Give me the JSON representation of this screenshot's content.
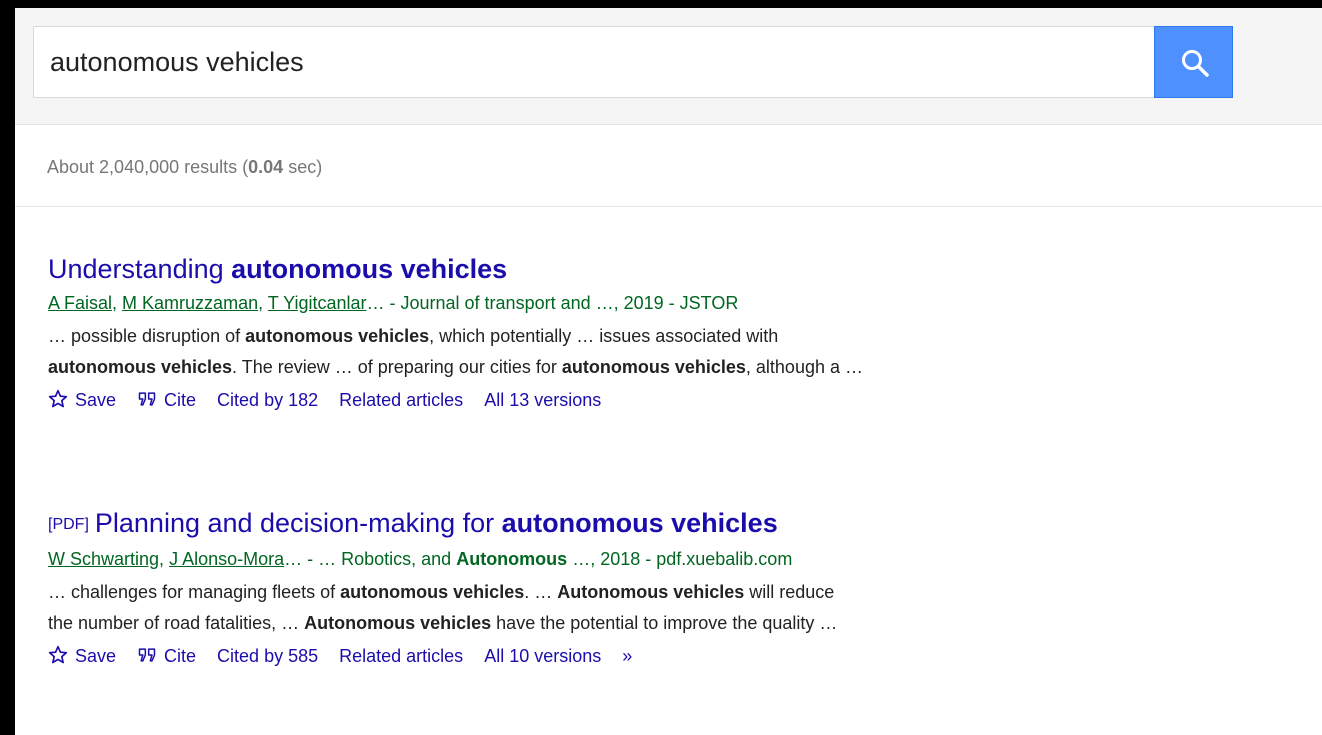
{
  "search": {
    "query": "autonomous vehicles",
    "button_icon": "search-icon",
    "button_color": "#4d90fe"
  },
  "stats": {
    "prefix": "About 2,040,000 results (",
    "time": "0.04",
    "suffix": " sec)"
  },
  "results": [
    {
      "pdf_tag": "",
      "title_prefix": "Understanding ",
      "title_keyword": "autonomous vehicles",
      "title_suffix": "",
      "authors": [
        "A Faisal",
        "M Kamruzzaman",
        "T Yigitcanlar"
      ],
      "author_sep_1": ", ",
      "author_sep_2": ", ",
      "meta_prefix": "… - Journal of transport and …, 2019 - JSTOR",
      "meta_keyword": "",
      "meta_suffix": "",
      "snippet_line1": {
        "a": "… possible disruption of ",
        "kw1": "autonomous vehicles",
        "b": ", which potentially … issues associated with"
      },
      "snippet_line2": {
        "kw1": "autonomous vehicles",
        "a": ". The review … of preparing our cities for ",
        "kw2": "autonomous vehicles",
        "b": ", although a …"
      },
      "actions": {
        "save": "Save",
        "cite": "Cite",
        "cited_by": "Cited by 182",
        "related": "Related articles",
        "versions": "All 13 versions",
        "more": ""
      }
    },
    {
      "pdf_tag": "[PDF]",
      "title_prefix": "Planning and decision-making for ",
      "title_keyword": "autonomous vehicles",
      "title_suffix": "",
      "authors": [
        "W Schwarting",
        "J Alonso-Mora"
      ],
      "author_sep_1": ", ",
      "meta_prefix": "… - … Robotics, and ",
      "meta_keyword": "Autonomous",
      "meta_suffix": " …, 2018 - pdf.xuebalib.com",
      "snippet_line1": {
        "a": "… challenges for managing fleets of ",
        "kw1": "autonomous vehicles",
        "b": ". … ",
        "kw2": "Autonomous vehicles",
        "c": " will reduce"
      },
      "snippet_line2": {
        "a": "the number of road fatalities, … ",
        "kw1": "Autonomous vehicles",
        "b": " have the potential to improve the quality …"
      },
      "actions": {
        "save": "Save",
        "cite": "Cite",
        "cited_by": "Cited by 585",
        "related": "Related articles",
        "versions": "All 10 versions",
        "more": "»"
      }
    }
  ],
  "colors": {
    "link": "#1a0dab",
    "meta_green": "#006621",
    "stats_gray": "#777777"
  }
}
